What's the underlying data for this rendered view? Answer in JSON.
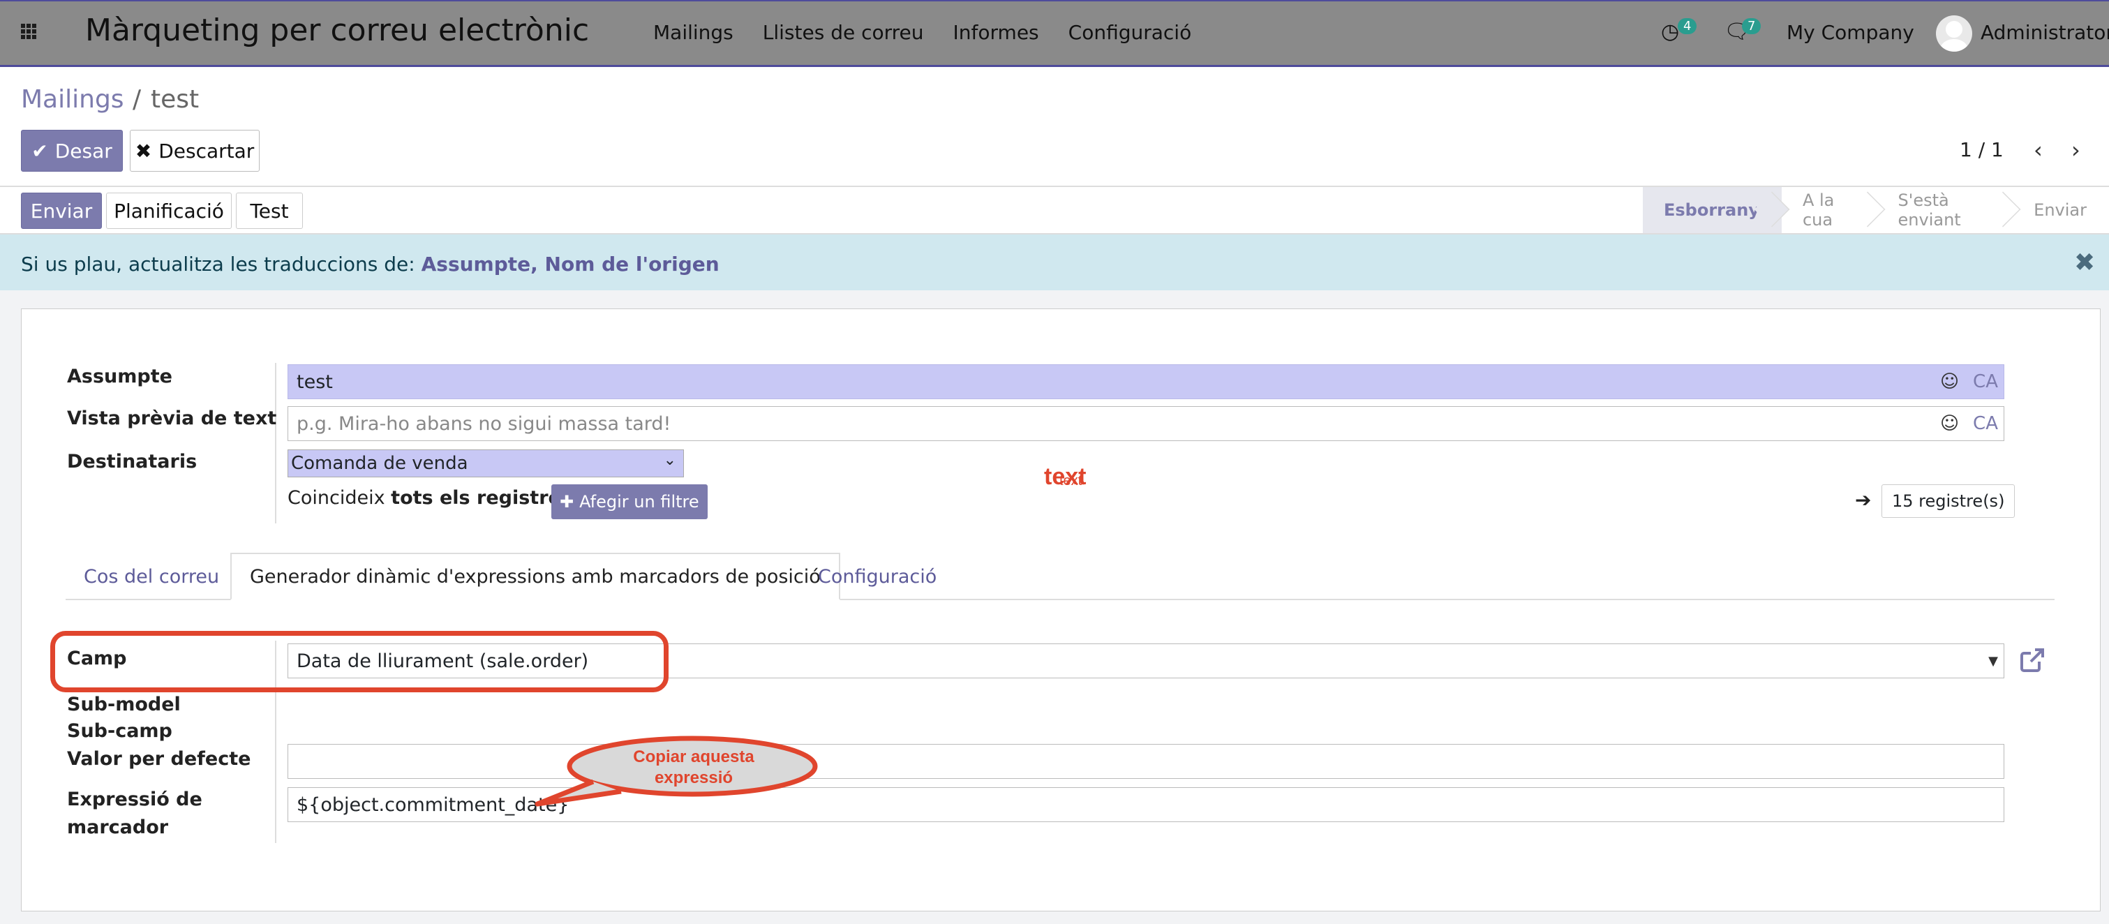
{
  "app": {
    "title": "Màrqueting per correu electrònic"
  },
  "nav": {
    "menu": [
      "Mailings",
      "Llistes de correu",
      "Informes",
      "Configuració"
    ],
    "activities_count": "4",
    "messages_count": "7",
    "company": "My Company",
    "user": "Administrator"
  },
  "breadcrumb": {
    "parent": "Mailings",
    "separator": "/",
    "current": "test"
  },
  "actions": {
    "save": "Desar",
    "discard": "Descartar"
  },
  "pager": {
    "value": "1 / 1"
  },
  "status_buttons": {
    "send": "Enviar",
    "schedule": "Planificació",
    "test": "Test"
  },
  "stages": [
    {
      "label": "Esborrany",
      "active": true
    },
    {
      "label": "A la cua",
      "active": false
    },
    {
      "label": "S'està enviant",
      "active": false
    },
    {
      "label": "Enviar",
      "active": false
    }
  ],
  "alert": {
    "prefix": "Si us plau, actualitza les traduccions de:",
    "fields": "Assumpte, Nom de l'origen"
  },
  "form": {
    "subject_label": "Assumpte",
    "subject_value": "test",
    "lang_code": "CA",
    "preview_label": "Vista prèvia de text",
    "preview_placeholder": "p.g. Mira-ho abans no sigui massa tard!",
    "recipients_label": "Destinataris",
    "recipients_value": "Comanda de venda",
    "match_prefix": "Coincideix",
    "match_bold": "tots els registres",
    "add_filter": "Afegir un filtre",
    "records": "15 registre(s)",
    "overlay_text": "text"
  },
  "tabs": [
    {
      "label": "Cos del correu",
      "active": false
    },
    {
      "label": "Generador dinàmic d'expressions amb marcadors de posició",
      "active": true
    },
    {
      "label": "Configuració",
      "active": false
    }
  ],
  "placeholder_tab": {
    "field_label": "Camp",
    "field_value": "Data de lliurament (sale.order)",
    "submodel_label": "Sub-model",
    "subfield_label": "Sub-camp",
    "default_label": "Valor per defecte",
    "expression_label_1": "Expressió de",
    "expression_label_2": "marcador",
    "expression_value": "${object.commitment_date}"
  },
  "annotation": {
    "callout_line1": "Copiar aquesta",
    "callout_line2": "expressió",
    "color": "#e0452d"
  },
  "colors": {
    "primary": "#7c7bad",
    "navbar": "#8a8a8a",
    "alert_bg": "#d0e8ef"
  }
}
